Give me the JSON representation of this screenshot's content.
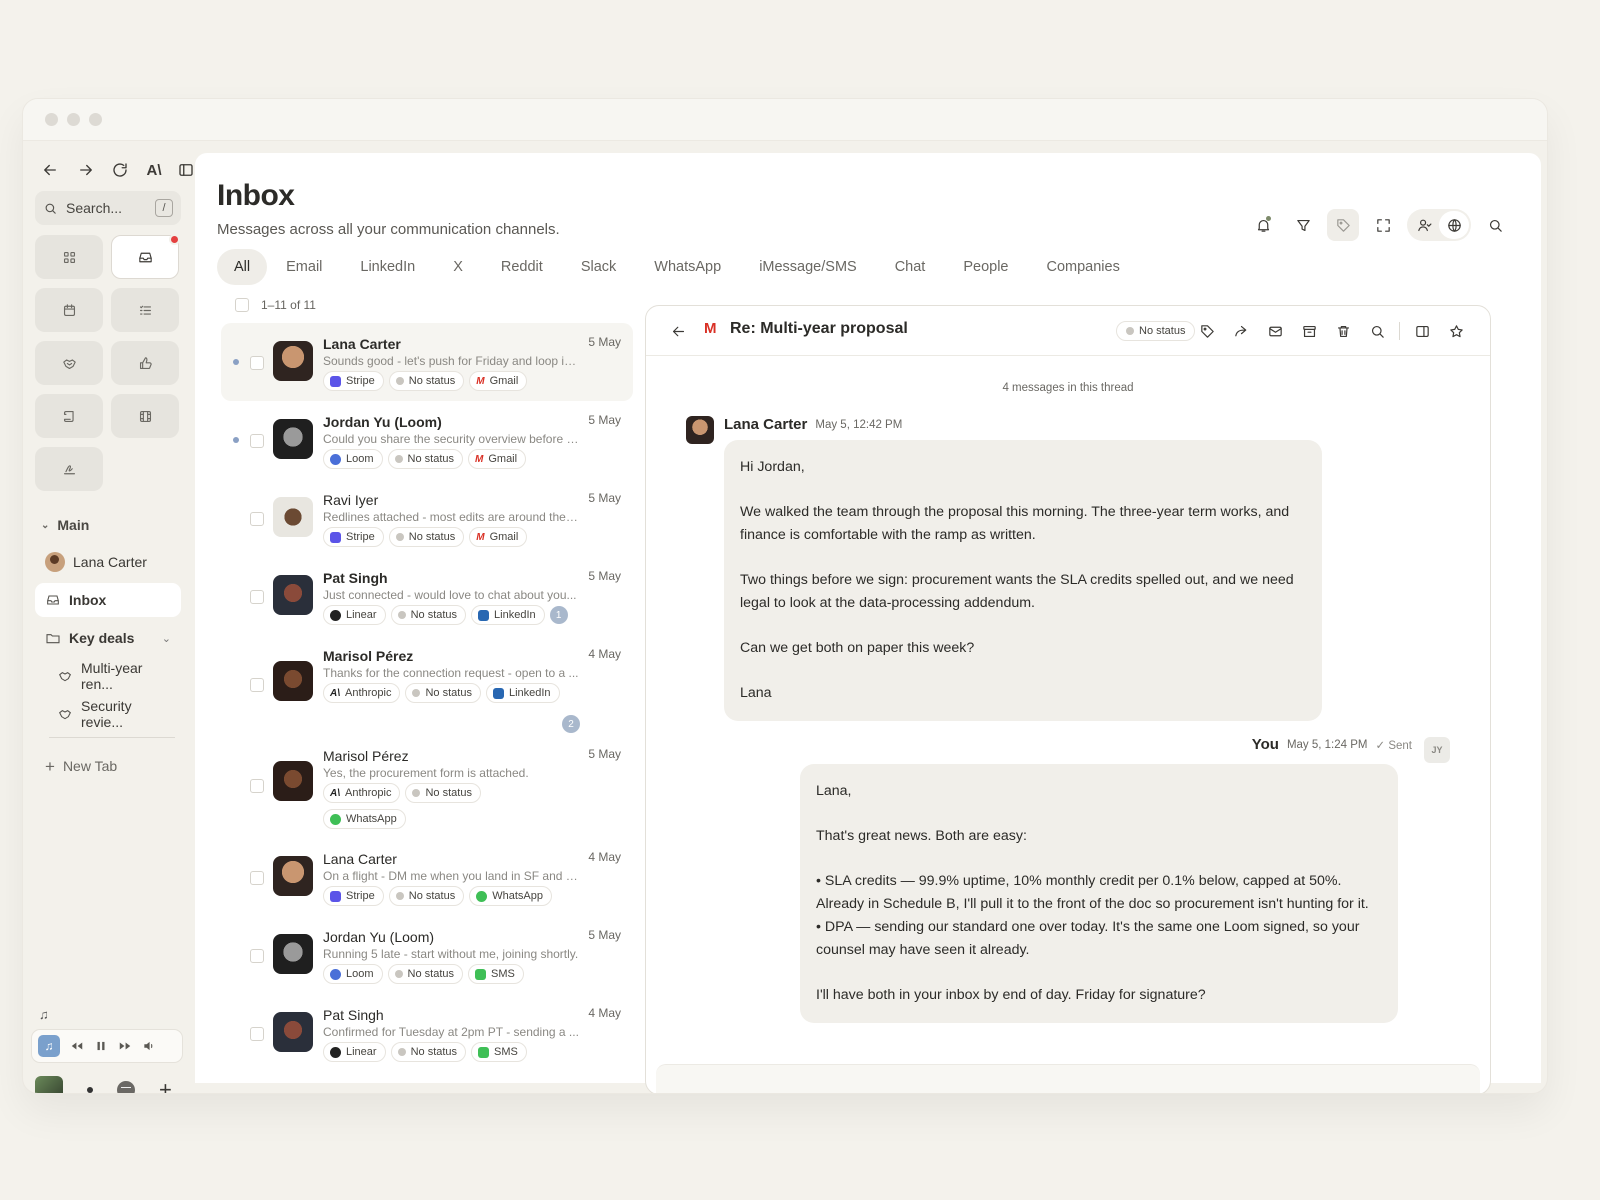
{
  "sidebar": {
    "search_placeholder": "Search...",
    "search_shortcut": "/",
    "section_main": "Main",
    "items": [
      {
        "label": "Lana Carter"
      },
      {
        "label": "Inbox"
      },
      {
        "label": "Key deals"
      },
      {
        "label": "Multi-year ren..."
      },
      {
        "label": "Security revie..."
      }
    ],
    "new_tab": "New Tab",
    "player_note": "♫"
  },
  "header": {
    "title": "Inbox",
    "subtitle": "Messages across all your communication channels."
  },
  "tabs": [
    "All",
    "Email",
    "LinkedIn",
    "X",
    "Reddit",
    "Slack",
    "WhatsApp",
    "iMessage/SMS",
    "Chat",
    "People",
    "Companies"
  ],
  "list": {
    "range": "1–11 of 11",
    "rows": [
      {
        "name": "Lana Carter",
        "date": "5 May",
        "preview": "Sounds good - let's push for Friday and loop in...",
        "company": "Stripe",
        "status": "No status",
        "channel": "Gmail"
      },
      {
        "name": "Jordan Yu (Loom)",
        "date": "5 May",
        "preview": "Could you share the security overview before o...",
        "company": "Loom",
        "status": "No status",
        "channel": "Gmail"
      },
      {
        "name": "Ravi Iyer",
        "date": "5 May",
        "preview": "Redlines attached - most edits are around the ...",
        "company": "Stripe",
        "status": "No status",
        "channel": "Gmail"
      },
      {
        "name": "Pat Singh",
        "date": "5 May",
        "preview": "Just connected - would love to chat about you...",
        "company": "Linear",
        "status": "No status",
        "channel": "LinkedIn",
        "count": "1"
      },
      {
        "name": "Marisol Pérez",
        "date": "4 May",
        "preview": "Thanks for the connection request - open to a ...",
        "company": "Anthropic",
        "status": "No status",
        "channel": "LinkedIn",
        "count": "2"
      },
      {
        "name": "Marisol Pérez",
        "date": "5 May",
        "preview": "Yes, the procurement form is attached.",
        "company": "Anthropic",
        "status": "No status",
        "channel": "WhatsApp"
      },
      {
        "name": "Lana Carter",
        "date": "4 May",
        "preview": "On a flight - DM me when you land in SF and w...",
        "company": "Stripe",
        "status": "No status",
        "channel": "WhatsApp"
      },
      {
        "name": "Jordan Yu (Loom)",
        "date": "5 May",
        "preview": "Running 5 late - start without me, joining shortly.",
        "company": "Loom",
        "status": "No status",
        "channel": "SMS"
      },
      {
        "name": "Pat Singh",
        "date": "4 May",
        "preview": "Confirmed for Tuesday at 2pm PT - sending a ...",
        "company": "Linear",
        "status": "No status",
        "channel": "SMS"
      }
    ]
  },
  "detail": {
    "subject": "Re: Multi-year proposal",
    "status": "No status",
    "thread_note": "4 messages in this thread",
    "msg1": {
      "sender": "Lana Carter",
      "time": "May 5, 12:42 PM",
      "paragraphs": [
        "Hi Jordan,",
        "We walked the team through the proposal this morning. The three-year term works, and finance is comfortable with the ramp as written.",
        "Two things before we sign: procurement wants the SLA credits spelled out, and we need legal to look at the data-processing addendum.",
        "Can we get both on paper this week?",
        "Lana"
      ]
    },
    "msg2": {
      "sender": "You",
      "time": "May 5, 1:24 PM",
      "sent": "✓ Sent",
      "initials": "JY",
      "p1": "Lana,",
      "p2": "That's great news. Both are easy:",
      "p3a": "• SLA credits — 99.9% uptime, 10% monthly credit per 0.1% below, capped at 50%. Already in Schedule B, I'll pull it to the front of the doc so procurement isn't hunting for it.",
      "p3b": "• DPA — sending our standard one over today. It's the same one Loom signed, so your counsel may have seen it already.",
      "p4": "I'll have both in your inbox by end of day. Friday for signature?"
    }
  },
  "colors": {
    "accent_red": "#e44040",
    "gmail": "#d93025",
    "stripe": "#5b54e8",
    "linkedin": "#2867b2",
    "whatsapp": "#3fbf56"
  }
}
